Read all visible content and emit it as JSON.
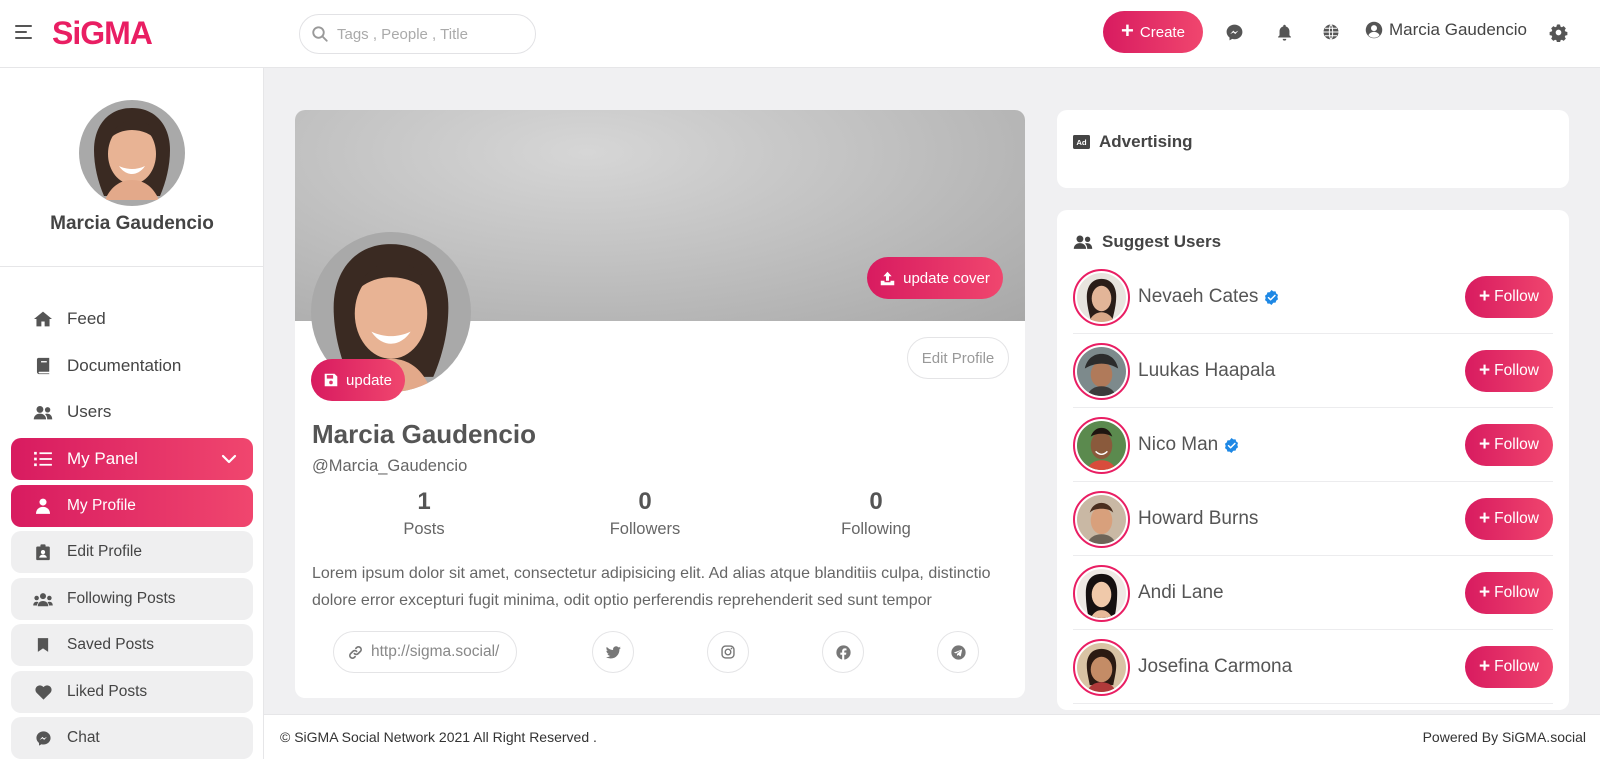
{
  "app": {
    "logo": "SiGMA"
  },
  "header": {
    "search_placeholder": "Tags , People , Title",
    "create_label": "Create",
    "user_name": "Marcia Gaudencio"
  },
  "sidebar": {
    "user_name": "Marcia Gaudencio",
    "items": [
      {
        "label": "Feed",
        "icon": "home-icon"
      },
      {
        "label": "Documentation",
        "icon": "book-icon"
      },
      {
        "label": "Users",
        "icon": "users-icon"
      },
      {
        "label": "My Panel",
        "icon": "list-icon"
      },
      {
        "label": "My Profile",
        "icon": "user-icon"
      },
      {
        "label": "Edit Profile",
        "icon": "id-card-icon"
      },
      {
        "label": "Following Posts",
        "icon": "users-icon"
      },
      {
        "label": "Saved Posts",
        "icon": "bookmark-icon"
      },
      {
        "label": "Liked Posts",
        "icon": "heart-icon"
      },
      {
        "label": "Chat",
        "icon": "messenger-icon"
      }
    ]
  },
  "profile": {
    "update_cover_label": "update cover",
    "update_label": "update",
    "edit_profile_label": "Edit Profile",
    "name": "Marcia Gaudencio",
    "handle": "@Marcia_Gaudencio",
    "stats": [
      {
        "value": "1",
        "label": "Posts"
      },
      {
        "value": "0",
        "label": "Followers"
      },
      {
        "value": "0",
        "label": "Following"
      }
    ],
    "bio": "Lorem ipsum dolor sit amet, consectetur adipisicing elit. Ad alias atque blanditiis culpa, distinctio dolore error excepturi fugit minima, odit optio perferendis reprehenderit sed sunt tempor",
    "website": "http://sigma.social/"
  },
  "advertising": {
    "title": "Advertising"
  },
  "suggest": {
    "title": "Suggest Users",
    "follow_label": "Follow",
    "users": [
      {
        "name": "Nevaeh Cates",
        "verified": true
      },
      {
        "name": "Luukas Haapala",
        "verified": false
      },
      {
        "name": "Nico Man",
        "verified": true
      },
      {
        "name": "Howard Burns",
        "verified": false
      },
      {
        "name": "Andi Lane",
        "verified": false
      },
      {
        "name": "Josefina Carmona",
        "verified": false
      }
    ]
  },
  "footer": {
    "copyright": "© SiGMA Social Network 2021 All Right Reserved .",
    "powered": "Powered By SiGMA.social"
  },
  "colors": {
    "accent": "#e91e63",
    "accent_light": "#f0466e",
    "verified": "#1e88e5"
  }
}
